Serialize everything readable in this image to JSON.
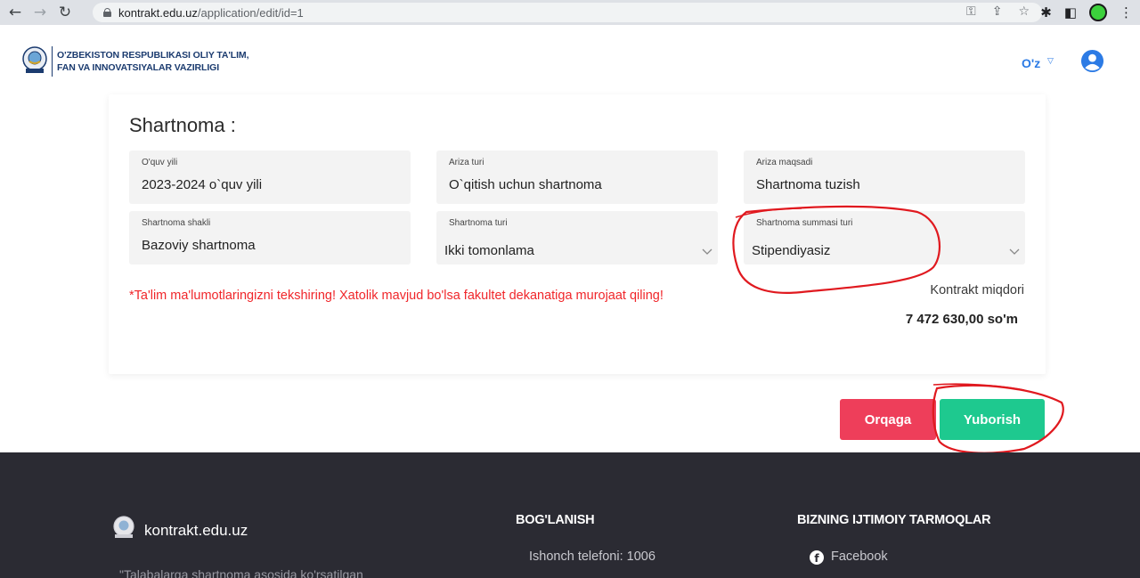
{
  "browser": {
    "url_host": "kontrakt.edu.uz",
    "url_path": "/application/edit/id=1"
  },
  "header": {
    "ministry_line1": "O'ZBEKISTON RESPUBLIKASI OLIY TA'LIM,",
    "ministry_line2": "FAN VA INNOVATSIYALAR VAZIRLIGI",
    "language": "O'z"
  },
  "contract": {
    "title": "Shartnoma :",
    "fields": [
      {
        "label": "O'quv yili",
        "value": "2023-2024 o`quv yili"
      },
      {
        "label": "Ariza turi",
        "value": "O`qitish uchun shartnoma"
      },
      {
        "label": "Ariza maqsadi",
        "value": "Shartnoma tuzish"
      },
      {
        "label": "Shartnoma shakli",
        "value": "Bazoviy shartnoma"
      },
      {
        "label": "Shartnoma turi",
        "value": "Ikki tomonlama"
      },
      {
        "label": "Shartnoma summasi turi",
        "value": "Stipendiyasiz"
      }
    ],
    "warning": "*Ta'lim ma'lumotlaringizni tekshiring! Xatolik mavjud bo'lsa fakultet dekanatiga murojaat qiling!",
    "amount_label": "Kontrakt miqdori",
    "amount_value": "7 472 630,00 so'm"
  },
  "actions": {
    "back_label": "Orqaga",
    "send_label": "Yuborish"
  },
  "footer": {
    "site": "kontrakt.edu.uz",
    "quote": "\"Talabalarga shartnoma asosida ko'rsatilgan",
    "contact_heading": "BOG'LANISH",
    "hotline": "Ishonch telefoni: 1006",
    "social_heading": "BIZNING IJTIMOIY TARMOQLAR",
    "facebook": "Facebook"
  },
  "colors": {
    "accent_blue": "#2c7be5",
    "danger": "#ee3e5a",
    "success": "#1ec98f",
    "warning_text": "#f0262a",
    "footer_bg": "#2b2b33"
  }
}
